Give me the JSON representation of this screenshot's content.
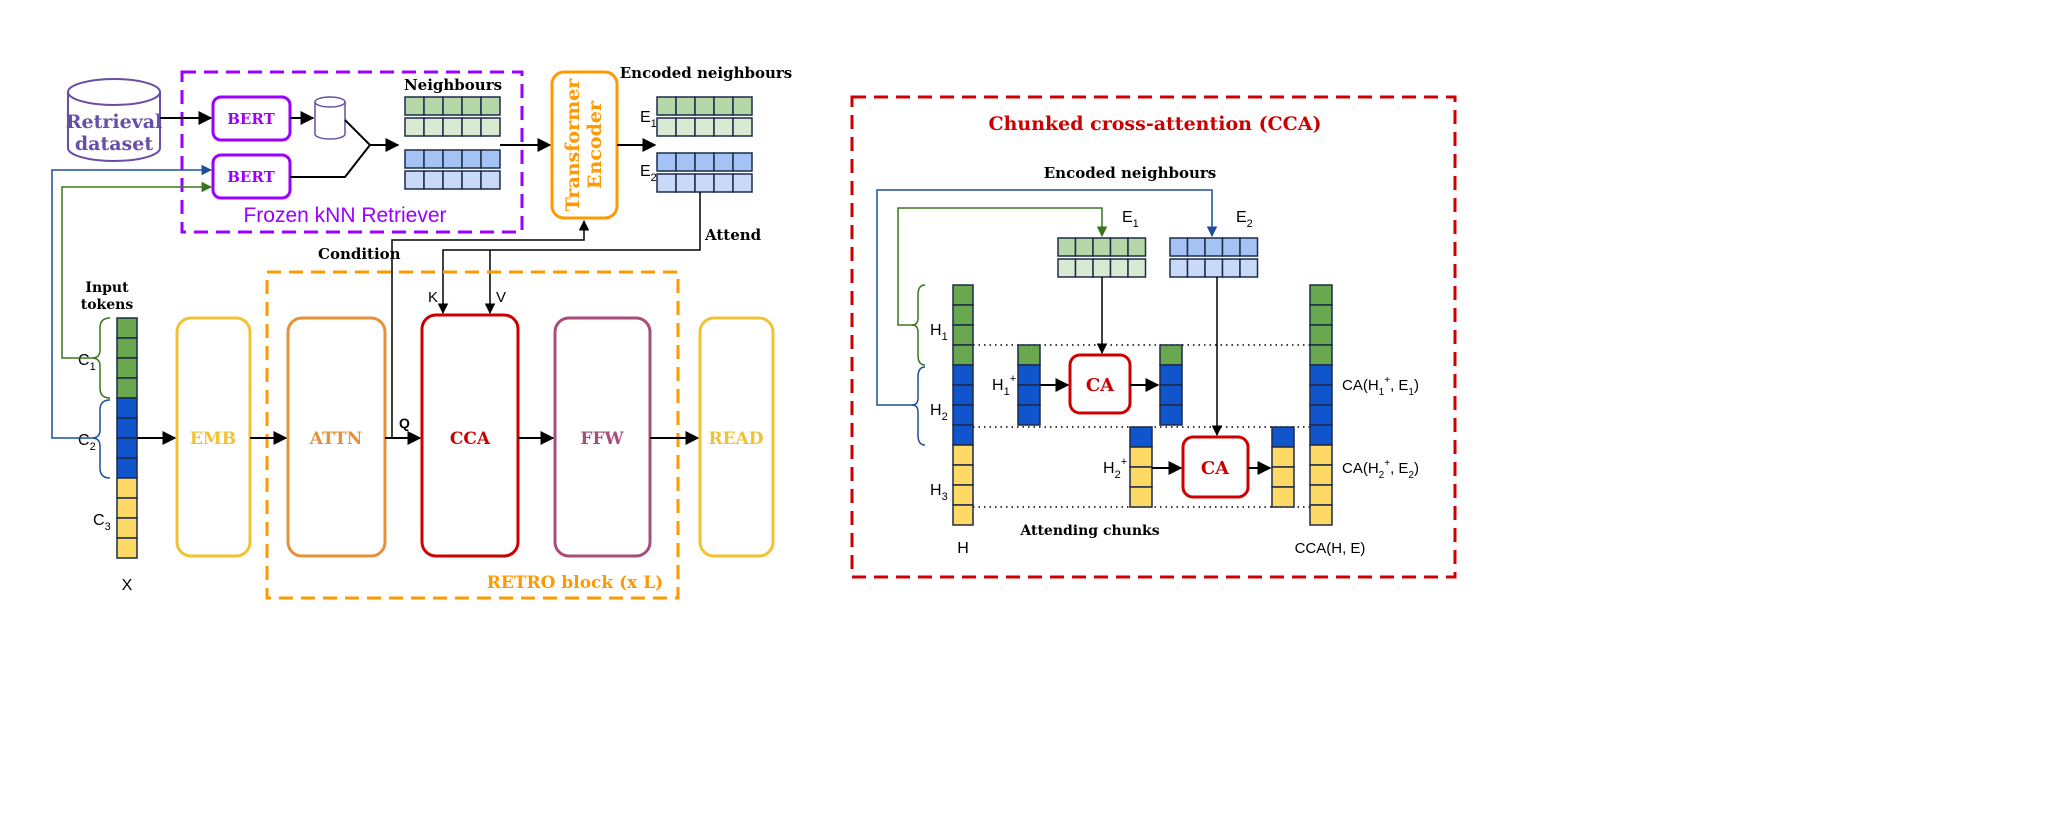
{
  "colors": {
    "green": "#6AA84F",
    "blue": "#1155CC",
    "yellow": "#FFD966",
    "light_green_1": "#B6D7A8",
    "light_green_2": "#D9EAD3",
    "light_blue_1": "#A4C2F4",
    "light_blue_2": "#C9DAF8",
    "retriever": "#9900FF",
    "encoder": "#FF9900",
    "emb": "#F1C232",
    "attn": "#E69138",
    "cca": "#CC0000",
    "ffw": "#A64D79",
    "dataset": "#674EA7"
  },
  "retro": {
    "retrieval_dataset": [
      "Retrieval",
      "dataset"
    ],
    "bert_1": "BERT",
    "bert_2": "BERT",
    "neighbours": "Neighbours",
    "retriever_label": "Frozen kNN Retriever",
    "encoder": [
      "Transformer",
      "Encoder"
    ],
    "encoded_neighbours": "Encoded neighbours",
    "e1": {
      "base": "E",
      "sub": "1"
    },
    "e2": {
      "base": "E",
      "sub": "2"
    },
    "attend": "Attend",
    "condition": "Condition",
    "input_tokens": [
      "Input",
      "tokens"
    ],
    "c1": {
      "base": "C",
      "sub": "1"
    },
    "c2": {
      "base": "C",
      "sub": "2"
    },
    "c3": {
      "base": "C",
      "sub": "3"
    },
    "x": "X",
    "k": "K",
    "v": "V",
    "q": "Q",
    "blocks": {
      "emb": "EMB",
      "attn": "ATTN",
      "cca": "CCA",
      "ffw": "FFW",
      "read": "READ"
    },
    "retro_block": "RETRO block (x L)"
  },
  "cca": {
    "title": "Chunked cross-attention (CCA)",
    "encoded_neighbours": "Encoded neighbours",
    "e1": {
      "base": "E",
      "sub": "1"
    },
    "e2": {
      "base": "E",
      "sub": "2"
    },
    "h1": {
      "base": "H",
      "sub": "1"
    },
    "h2": {
      "base": "H",
      "sub": "2"
    },
    "h3": {
      "base": "H",
      "sub": "3"
    },
    "h1_plus": {
      "base": "H",
      "sub": "1",
      "sup": "+"
    },
    "h2_plus": {
      "base": "H",
      "sub": "2",
      "sup": "+"
    },
    "ca_1": "CA",
    "ca_2": "CA",
    "out_1": [
      "CA(H",
      "1",
      "+",
      ", E",
      "1",
      ")"
    ],
    "out_2": [
      "CA(H",
      "2",
      "+",
      ", E",
      "2",
      ")"
    ],
    "h": "H",
    "cca_out": "CCA(H, E)",
    "attending_chunks": "Attending chunks"
  }
}
